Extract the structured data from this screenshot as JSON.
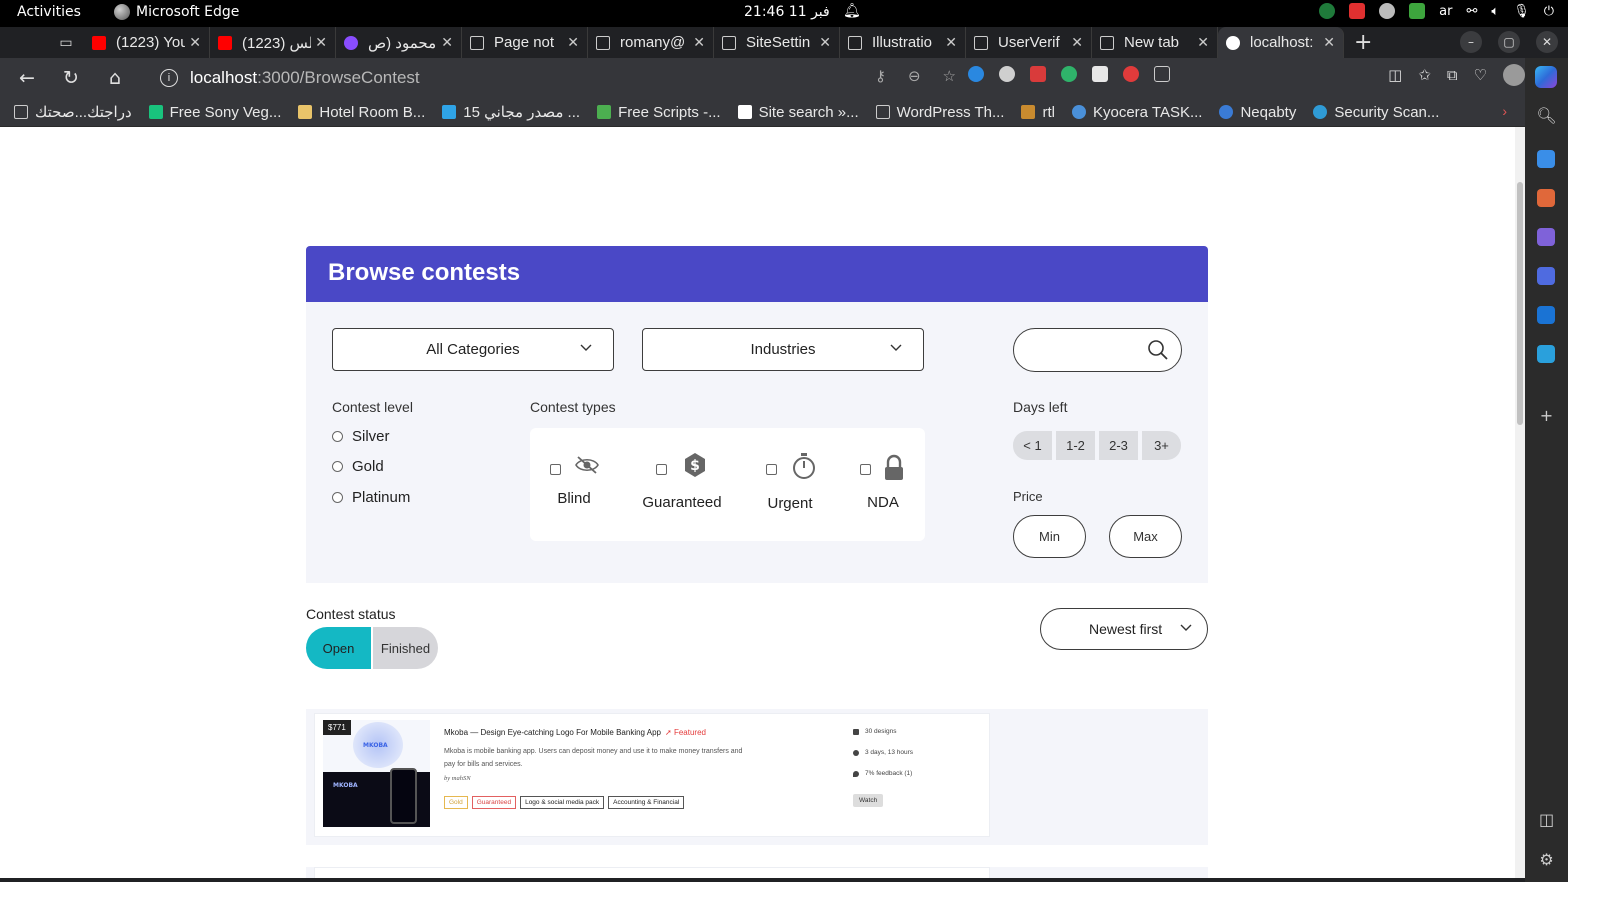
{
  "system": {
    "activities": "Activities",
    "app_name": "Microsoft Edge",
    "clock": "21:46  11 فبر",
    "lang": "ar"
  },
  "tabs": [
    {
      "label": "(1223) You",
      "favicon": "#ff0000"
    },
    {
      "label": "(1223) الس",
      "favicon": "#ff0000"
    },
    {
      "label": "محمود (ص",
      "favicon": "#8a4dff"
    },
    {
      "label": "Page not",
      "favicon": "#cccccc"
    },
    {
      "label": "romany@",
      "favicon": "#cccccc"
    },
    {
      "label": "SiteSettin",
      "favicon": "#cccccc"
    },
    {
      "label": "Illustratio",
      "favicon": "#cccccc"
    },
    {
      "label": "UserVerif",
      "favicon": "#cccccc"
    },
    {
      "label": "New tab",
      "favicon": "#cccccc"
    },
    {
      "label": "localhost:",
      "favicon": "#ffffff"
    }
  ],
  "address": {
    "host": "localhost",
    "path": ":3000/BrowseContest"
  },
  "bookmarks": [
    {
      "label": "دراجتك...صحتك",
      "color": "#cccccc"
    },
    {
      "label": "Free Sony Veg...",
      "color": "#19c37d"
    },
    {
      "label": "Hotel Room B...",
      "color": "#e9c46a"
    },
    {
      "label": "15 مصدر مجاني ...",
      "color": "#2fa4e7"
    },
    {
      "label": "Free Scripts -...",
      "color": "#4caf50"
    },
    {
      "label": "Site search »...",
      "color": "#ffffff"
    },
    {
      "label": "WordPress Th...",
      "color": "#cccccc"
    },
    {
      "label": "rtl",
      "color": "#c98b2f"
    },
    {
      "label": "Kyocera TASK...",
      "color": "#4a90d9"
    },
    {
      "label": "Neqabty",
      "color": "#3a7bd5"
    },
    {
      "label": "Security Scan...",
      "color": "#2f9bd6"
    }
  ],
  "page": {
    "title": "Browse contests",
    "categories_select": "All Categories",
    "industries_select": "Industries",
    "search_placeholder": "",
    "contest_level": {
      "label": "Contest level",
      "options": [
        "Silver",
        "Gold",
        "Platinum"
      ]
    },
    "contest_types": {
      "label": "Contest types",
      "options": [
        "Blind",
        "Guaranteed",
        "Urgent",
        "NDA"
      ]
    },
    "days_left": {
      "label": "Days left",
      "options": [
        "< 1",
        "1-2",
        "2-3",
        "3+"
      ]
    },
    "price": {
      "label": "Price",
      "min": "Min",
      "max": "Max"
    },
    "contest_status": {
      "label": "Contest status",
      "open": "Open",
      "finished": "Finished"
    },
    "sort": "Newest first"
  },
  "contests": [
    {
      "price": "$771",
      "title": "Mkoba — Design Eye-catching Logo For Mobile Banking App",
      "featured": "Featured",
      "description": "Mkoba is mobile banking app. Users can deposit money and use it to make money transfers and pay for bills and services.",
      "by": "by mahSN",
      "tags": [
        "Gold",
        "Guaranteed",
        "Logo & social media pack",
        "Accounting & Financial"
      ],
      "designs": "30 designs",
      "time_left": "3 days, 13 hours",
      "feedback": "7% feedback (1)",
      "watch": "Watch",
      "thumb_brand": "MKOBA"
    }
  ],
  "colors": {
    "header": "#4a48c6",
    "open_toggle": "#14b8c4",
    "filter_bg": "#f4f5fa"
  }
}
